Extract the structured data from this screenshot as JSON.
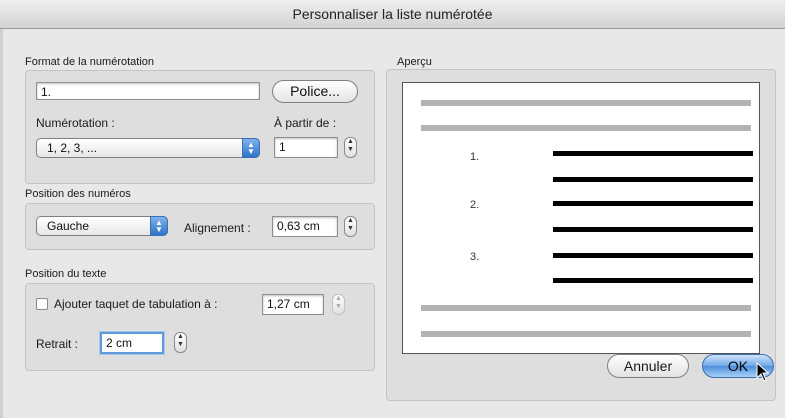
{
  "window": {
    "title": "Personnaliser la liste numérotée"
  },
  "format": {
    "section_label": "Format de la numérotation",
    "format_value": "1.",
    "font_button": "Police...",
    "numbering_label": "Numérotation :",
    "numbering_value": "1, 2, 3, ...",
    "start_label": "À partir de :",
    "start_value": "1"
  },
  "number_position": {
    "section_label": "Position des numéros",
    "align_value": "Gauche",
    "alignment_label": "Alignement :",
    "alignment_value": "0,63 cm"
  },
  "text_position": {
    "section_label": "Position du texte",
    "tab_checkbox_label": "Ajouter taquet de tabulation à :",
    "tab_checked": false,
    "tab_value": "1,27 cm",
    "indent_label": "Retrait :",
    "indent_value": "2 cm"
  },
  "preview": {
    "label": "Aperçu",
    "numbers": [
      "1.",
      "2.",
      "3."
    ]
  },
  "buttons": {
    "cancel": "Annuler",
    "ok": "OK"
  }
}
